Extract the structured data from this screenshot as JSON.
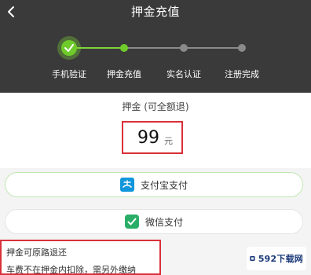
{
  "header": {
    "title": "押金充值"
  },
  "stepper": {
    "steps": [
      {
        "label": "手机验证",
        "state": "done"
      },
      {
        "label": "押金充值",
        "state": "current"
      },
      {
        "label": "实名认证",
        "state": "pending"
      },
      {
        "label": "注册完成",
        "state": "pending"
      }
    ]
  },
  "deposit": {
    "label": "押金 (可全额退)",
    "amount": "99",
    "unit": "元"
  },
  "payments": {
    "alipay_label": "支付宝支付",
    "wechat_label": "微信支付"
  },
  "notice": {
    "line1": "押金可原路退还",
    "line2": "车费不在押金内扣除，需另外缴纳"
  },
  "watermark": {
    "text": "592下载网"
  },
  "colors": {
    "header_bg": "#3a3a3a",
    "accent_green": "#6fcb2a",
    "highlight_red": "#d9313a",
    "alipay_blue": "#1296db",
    "wechat_green": "#2aae67"
  }
}
